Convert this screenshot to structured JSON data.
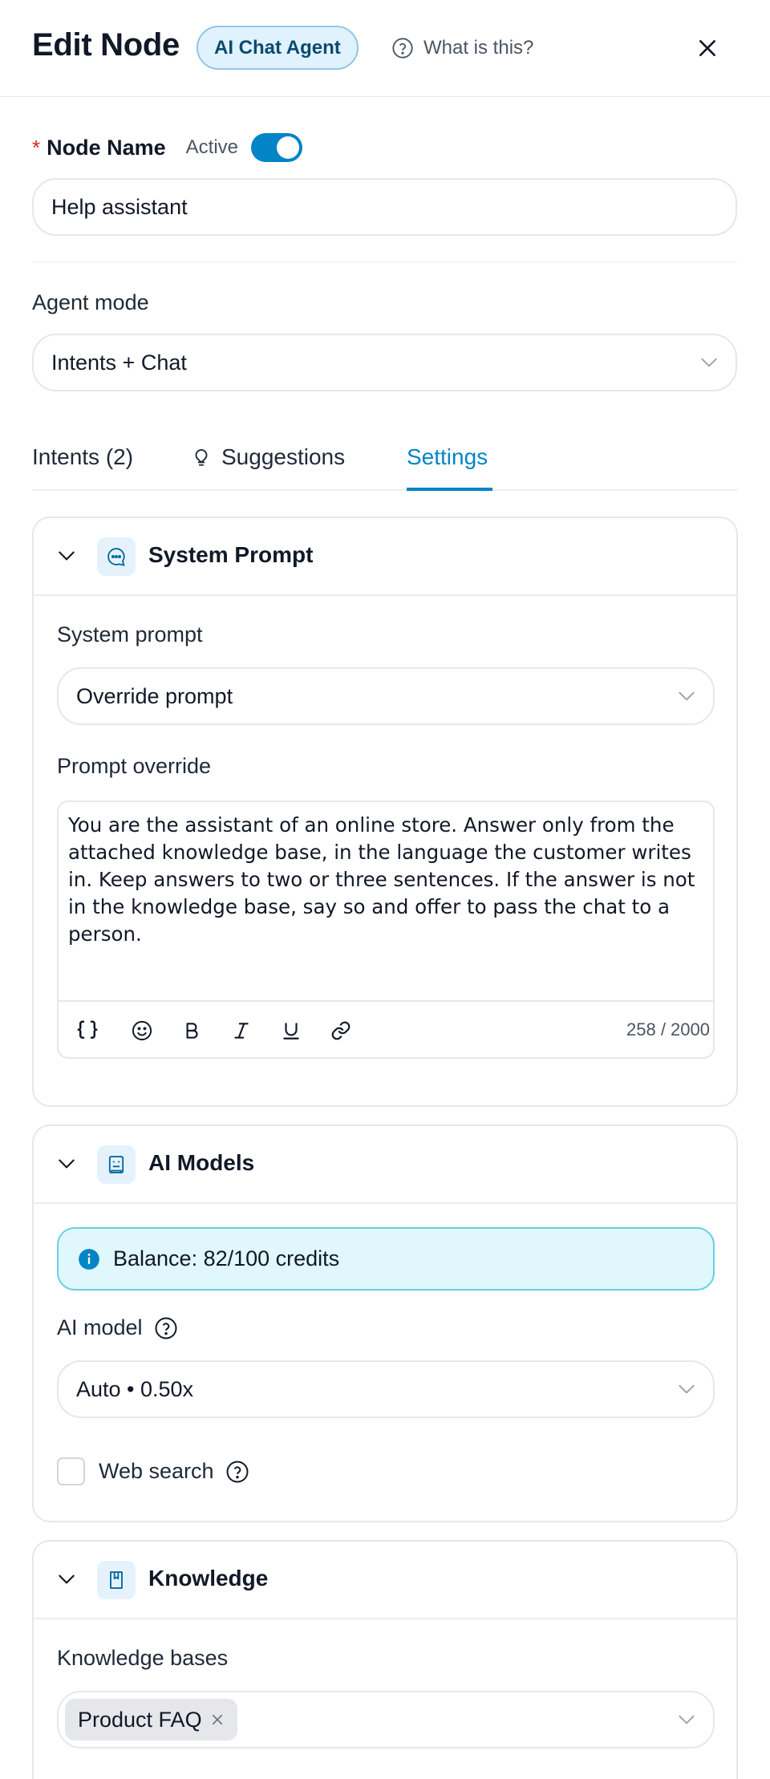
{
  "header": {
    "title": "Edit Node",
    "badge": "AI Chat Agent",
    "help_text": "What is this?"
  },
  "node_name": {
    "required_mark": "*",
    "label": "Node Name",
    "active_label": "Active",
    "active": true,
    "value": "Help assistant"
  },
  "agent_mode": {
    "label": "Agent mode",
    "value": "Intents + Chat"
  },
  "tabs": [
    {
      "label": "Intents (2)",
      "active": false
    },
    {
      "label": "Suggestions",
      "active": false,
      "icon": "lightbulb-icon"
    },
    {
      "label": "Settings",
      "active": true
    }
  ],
  "system_prompt_section": {
    "title": "System Prompt",
    "icon": "chat-bubble-icon",
    "system_prompt_label": "System prompt",
    "system_prompt_value": "Override prompt",
    "override_label": "Prompt override",
    "override_text": "You are the assistant of an online store. Answer only from the attached knowledge base, in the language the customer writes in. Keep answers to two or three sentences. If the answer is not in the knowledge base, say so and offer to pass the chat to a person.",
    "toolbar": [
      "variables-icon",
      "emoji-icon",
      "bold-icon",
      "italic-icon",
      "underline-icon",
      "link-icon"
    ],
    "char_count": "258 / 2000"
  },
  "ai_models_section": {
    "title": "AI Models",
    "icon": "robot-icon",
    "balance_text": "Balance: 82/100 credits",
    "model_label": "AI model",
    "model_value": "Auto • 0.50x",
    "web_search_label": "Web search",
    "web_search_checked": false
  },
  "knowledge_section": {
    "title": "Knowledge",
    "icon": "book-icon",
    "kb_label": "Knowledge bases",
    "selected": [
      "Product FAQ"
    ]
  },
  "colors": {
    "accent": "#0284c7",
    "required": "#dc2626",
    "badge_bg": "#e0f2fe",
    "info_bg": "#e0f7fb"
  }
}
